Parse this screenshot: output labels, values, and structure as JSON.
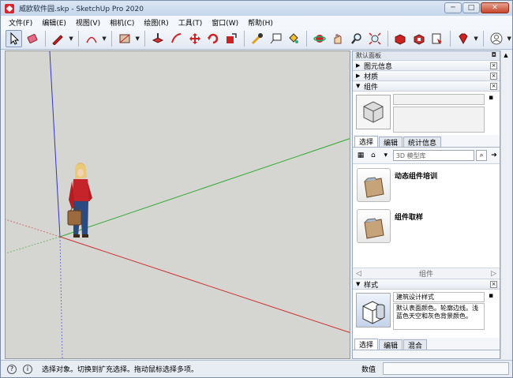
{
  "window": {
    "title": "威欧软件园.skp - SketchUp Pro 2020",
    "min_label": "─",
    "max_label": "□",
    "close_label": "✕"
  },
  "menu": [
    "文件(F)",
    "编辑(E)",
    "视图(V)",
    "相机(C)",
    "绘图(R)",
    "工具(T)",
    "窗口(W)",
    "帮助(H)"
  ],
  "toolbar": {
    "tools": [
      "select-tool-icon",
      "eraser-tool-icon",
      "pencil-line-tool-icon",
      "arc-tool-icon",
      "rectangle-tool-icon",
      "push-pull-tool-icon",
      "offset-tool-icon",
      "move-tool-icon",
      "rotate-tool-icon",
      "scale-tool-icon",
      "tape-measure-icon",
      "text-tool-icon",
      "paint-bucket-icon",
      "orbit-icon",
      "pan-icon",
      "zoom-icon",
      "zoom-extents-icon",
      "3d-warehouse-icon",
      "extension-warehouse-icon",
      "layout-icon",
      "ruby-icon",
      "account-icon"
    ]
  },
  "panel": {
    "header": "默认面板",
    "pin": "◘",
    "trays": {
      "entity_info": "图元信息",
      "materials": "材质",
      "components": "组件",
      "styles": "样式"
    },
    "components": {
      "tabs": [
        "选择",
        "编辑",
        "统计信息"
      ],
      "search_placeholder": "3D 模型库",
      "items": [
        {
          "label": "动态组件培训"
        },
        {
          "label": "组件取样"
        }
      ],
      "nav_label": "组件"
    },
    "styles": {
      "name": "建筑设计样式",
      "description": "默认表面颜色。轮廓边线。浅蓝色天空和灰色背景颜色。",
      "tabs": [
        "选择",
        "编辑",
        "混合"
      ]
    }
  },
  "status": {
    "message": "选择对象。切换到扩充选择。拖动鼠标选择多项。",
    "measure_label": "数值"
  },
  "colors": {
    "axis_red": "#cc3333",
    "axis_green": "#33aa33",
    "axis_blue": "#3333cc",
    "background": "#d5d5d1"
  }
}
